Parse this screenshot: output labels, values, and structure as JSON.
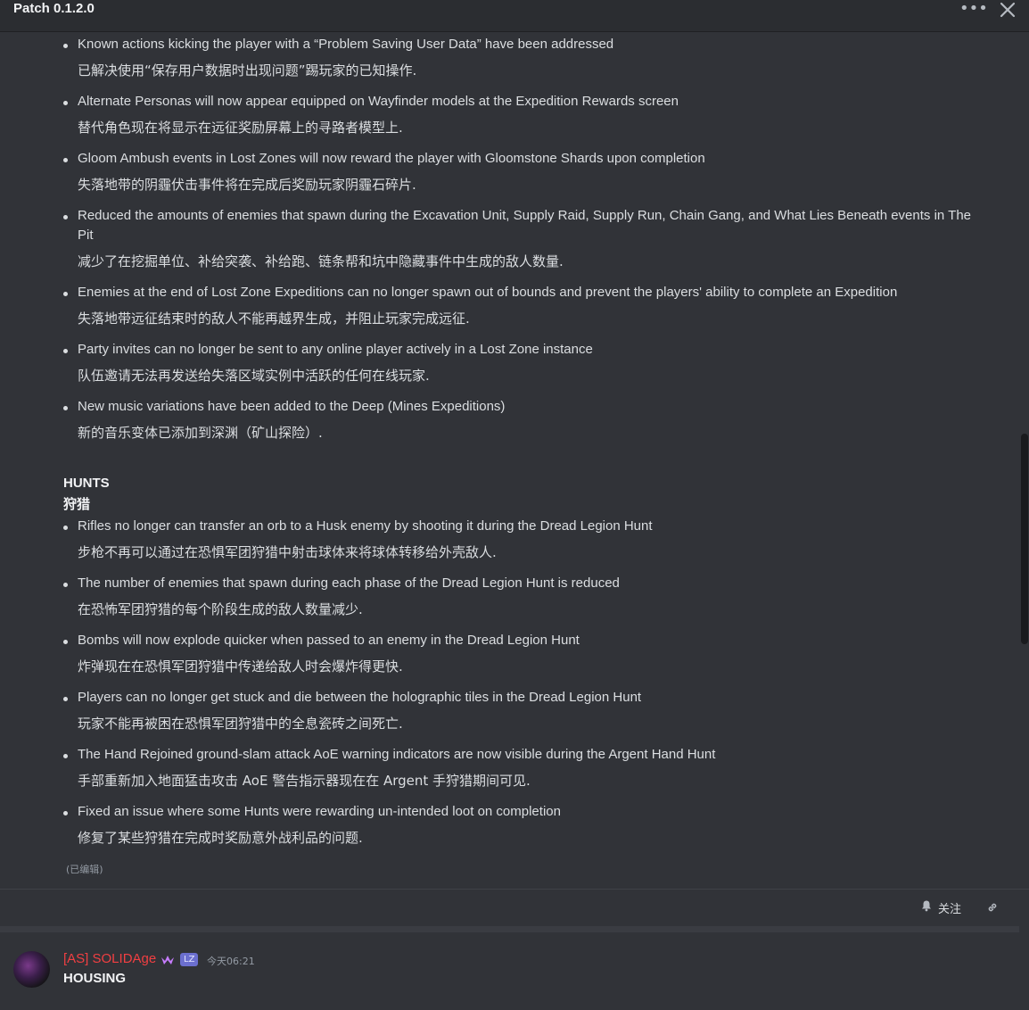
{
  "header": {
    "title": "Patch 0.1.2.0",
    "more_icon": "more-horizontal-icon",
    "close_icon": "close-icon"
  },
  "section1": {
    "items": [
      {
        "en": "Known actions kicking the player with a “Problem Saving User Data” have been addressed",
        "zh": "已解决使用“保存用户数据时出现问题”踢玩家的已知操作."
      },
      {
        "en": "Alternate Personas will now appear equipped on Wayfinder models at the Expedition Rewards screen",
        "zh": "替代角色现在将显示在远征奖励屏幕上的寻路者模型上."
      },
      {
        "en": "Gloom Ambush events in Lost Zones will now reward the player with Gloomstone Shards upon completion",
        "zh": "失落地带的阴霾伏击事件将在完成后奖励玩家阴霾石碎片."
      },
      {
        "en": "Reduced the amounts of enemies that spawn during the Excavation Unit, Supply Raid, Supply Run, Chain Gang, and What Lies Beneath events in The Pit",
        "zh": "减少了在挖掘单位、补给突袭、补给跑、链条帮和坑中隐藏事件中生成的敌人数量."
      },
      {
        "en": "Enemies at the end of Lost Zone Expeditions can no longer spawn out of bounds and prevent the players' ability to complete an Expedition",
        "zh": "失落地带远征结束时的敌人不能再越界生成，并阻止玩家完成远征."
      },
      {
        "en": "Party invites can no longer be sent to any online player actively in a Lost Zone instance",
        "zh": "队伍邀请无法再发送给失落区域实例中活跃的任何在线玩家."
      },
      {
        "en": "New music variations have been added to the Deep (Mines Expeditions)",
        "zh": "新的音乐变体已添加到深渊（矿山探险）."
      }
    ]
  },
  "section2": {
    "heading_en": "HUNTS",
    "heading_zh": "狩猎",
    "items": [
      {
        "en": "Rifles no longer can transfer an orb to a Husk enemy by shooting it during the Dread Legion Hunt",
        "zh": "步枪不再可以通过在恐惧军团狩猎中射击球体来将球体转移给外壳敌人."
      },
      {
        "en": "The number of enemies that spawn during each phase of the Dread Legion Hunt is reduced",
        "zh": "在恐怖军团狩猎的每个阶段生成的敌人数量减少."
      },
      {
        "en": "Bombs will now explode quicker when passed to an enemy in the Dread Legion Hunt",
        "zh": "炸弹现在在恐惧军团狩猎中传递给敌人时会爆炸得更快."
      },
      {
        "en": "Players can no longer get stuck and die between the holographic tiles in the Dread Legion Hunt",
        "zh": "玩家不能再被困在恐惧军团狩猎中的全息瓷砖之间死亡."
      },
      {
        "en": "The Hand Rejoined ground-slam attack AoE warning indicators are now visible during the Argent Hand Hunt",
        "zh": "手部重新加入地面猛击攻击 AoE 警告指示器现在在 Argent 手狩猎期间可见."
      },
      {
        "en": "Fixed an issue where some Hunts were rewarding un-intended loot on completion",
        "zh": "修复了某些狩猎在完成时奖励意外战利品的问题."
      }
    ]
  },
  "edited_label": "(已编辑)",
  "actions": {
    "follow_label": "关注",
    "follow_icon": "bell-icon",
    "link_icon": "link-icon"
  },
  "message": {
    "username": "[AS] SOLIDAge",
    "username_color": "#f23f42",
    "badge_icon": "crown-badge-icon",
    "tag": "LZ",
    "timestamp": "今天06:21",
    "text": "HOUSING"
  }
}
